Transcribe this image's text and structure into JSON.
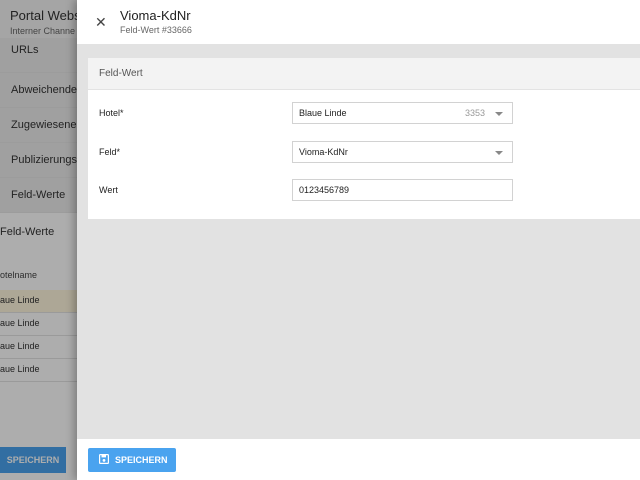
{
  "background": {
    "title": "Portal Websi",
    "subtitle": "Interner Channe",
    "nav": [
      {
        "label": "URLs"
      },
      {
        "label": "Abweichende"
      },
      {
        "label": "Zugewiesene"
      },
      {
        "label": "Publizierungs"
      },
      {
        "label": "Feld-Werte"
      }
    ],
    "section_title": "Feld-Werte",
    "table_header": "otelname",
    "rows": [
      {
        "name": "aue Linde"
      },
      {
        "name": "aue Linde"
      },
      {
        "name": "aue Linde"
      },
      {
        "name": "aue Linde"
      }
    ],
    "save_label": "SPEICHERN"
  },
  "drawer": {
    "title": "Vioma-KdNr",
    "subtitle": "Feld-Wert #33666",
    "close_icon": "close-icon",
    "card_title": "Feld-Wert",
    "fields": {
      "hotel": {
        "label": "Hotel*",
        "value": "Blaue Linde",
        "id_hint": "3353"
      },
      "feld": {
        "label": "Feld*",
        "value": "Vioma-KdNr"
      },
      "wert": {
        "label": "Wert",
        "value": "0123456789"
      }
    },
    "save_label": "SPEICHERN",
    "save_icon": "floppy-disk-icon"
  },
  "colors": {
    "accent": "#4aa3ef",
    "overlay": "#e2e2e2"
  }
}
